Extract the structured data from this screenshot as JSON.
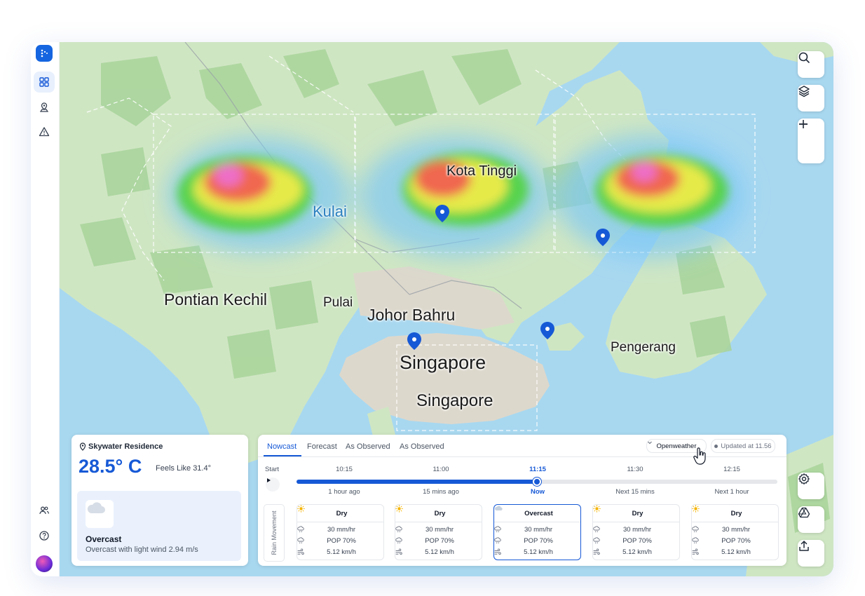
{
  "map": {
    "cities": {
      "kota_tinggi": "Kota Tinggi",
      "kulai": "Kulai",
      "pontian_kechil": "Pontian Kechil",
      "pulai": "Pulai",
      "johor_bahru": "Johor Bahru",
      "singapore_main": "Singapore",
      "singapore_sub": "Singapore",
      "pengerang": "Pengerang"
    }
  },
  "location": {
    "name": "Skywater Residence",
    "temperature": "28.5° C",
    "feels_like": "Feels Like 31.4°",
    "condition": "Overcast",
    "description": "Overcast with light wind 2.94 m/s"
  },
  "forecast": {
    "tabs": [
      "Nowcast",
      "Forecast",
      "As Observed",
      "As Observed"
    ],
    "provider": "Openweather",
    "updated": "Updated at 11.56",
    "start_label": "Start",
    "timeline": [
      "10:15",
      "11:00",
      "11:15",
      "11:30",
      "12:15"
    ],
    "relative": [
      "1 hour ago",
      "15 mins ago",
      "Now",
      "Next 15 mins",
      "Next 1 hour"
    ],
    "progress_fraction": 0.5,
    "side_label": "Rain Movement",
    "slots": [
      {
        "condition": "Dry",
        "rain": "30 mm/hr",
        "pop": "POP 70%",
        "wind": "5.12 km/h"
      },
      {
        "condition": "Dry",
        "rain": "30 mm/hr",
        "pop": "POP 70%",
        "wind": "5.12 km/h"
      },
      {
        "condition": "Overcast",
        "rain": "30 mm/hr",
        "pop": "POP 70%",
        "wind": "5.12 km/h"
      },
      {
        "condition": "Dry",
        "rain": "30 mm/hr",
        "pop": "POP 70%",
        "wind": "5.12 km/h"
      },
      {
        "condition": "Dry",
        "rain": "30 mm/hr",
        "pop": "POP 70%",
        "wind": "5.12 km/h"
      }
    ]
  },
  "colors": {
    "accent": "#1659d6",
    "water": "#a8d8f0",
    "land": "#cfe6c3",
    "urban": "#ddd8cc"
  }
}
